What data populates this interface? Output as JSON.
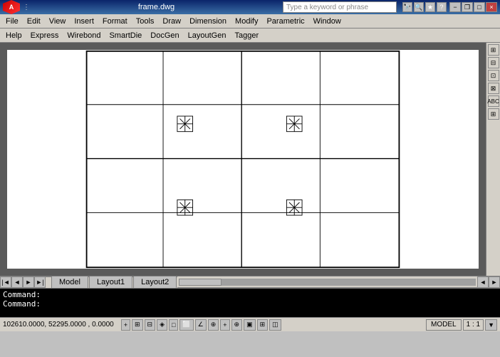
{
  "titlebar": {
    "title": "frame.dwg",
    "search_placeholder": "Type a keyword or phrase",
    "min_label": "−",
    "max_label": "□",
    "close_label": "×",
    "restore_label": "❐"
  },
  "menubar": {
    "items": [
      "File",
      "Edit",
      "View",
      "Insert",
      "Format",
      "Tools",
      "Draw",
      "Dimension",
      "Modify",
      "Parametric",
      "Window"
    ]
  },
  "toolbar2": {
    "items": [
      "Help",
      "Express",
      "Wirebond",
      "SmartDie",
      "DocGen",
      "LayoutGen",
      "Tagger"
    ]
  },
  "tabs": {
    "items": [
      "Model",
      "Layout1",
      "Layout2"
    ]
  },
  "command": {
    "line1": "Command:",
    "line2": "Command:"
  },
  "statusbar": {
    "coords": "102610.0000, 52295.0000 , 0.0000",
    "model_label": "MODEL",
    "zoom_label": "1 : 1",
    "buttons": [
      "+",
      "⊞",
      "⊟",
      "◈",
      "□",
      "⬜",
      "∠",
      "⊕",
      "+",
      "⊕",
      "▣",
      "⊞",
      "◫"
    ]
  },
  "icons": {
    "search": "🔍",
    "binoculars": "🔭",
    "star": "★",
    "help": "?",
    "left_arrow": "◄",
    "right_arrow": "►",
    "up_arrow": "▲",
    "down_arrow": "▼"
  }
}
